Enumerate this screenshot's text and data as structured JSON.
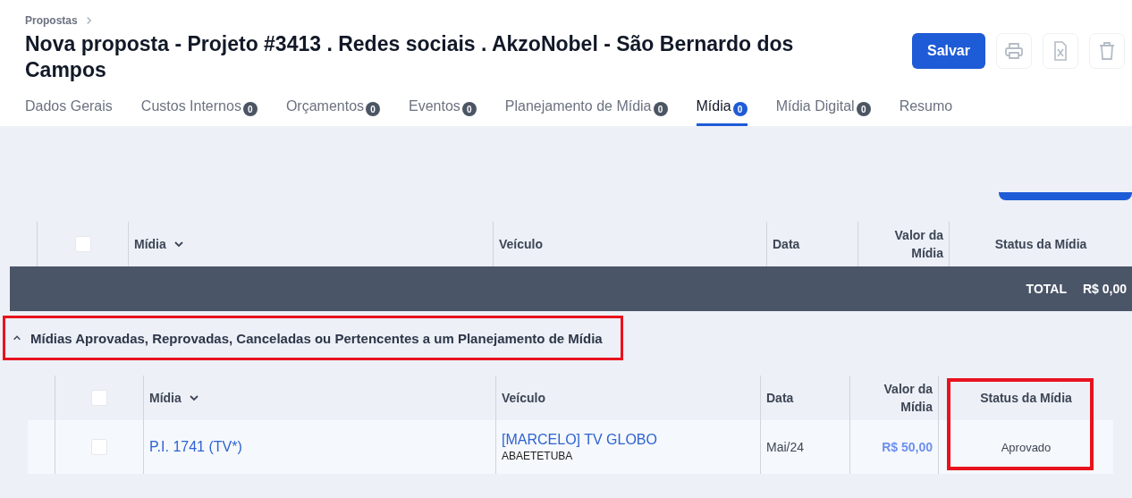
{
  "breadcrumb": "Propostas",
  "title": "Nova proposta - Projeto #3413 . Redes sociais . AkzoNobel - São Bernardo dos Campos",
  "save_button": "Salvar",
  "tabs": [
    {
      "label": "Dados Gerais",
      "selected": false
    },
    {
      "label": "Custos Internos",
      "count": "0",
      "selected": false
    },
    {
      "label": "Orçamentos",
      "count": "0",
      "selected": false
    },
    {
      "label": "Eventos",
      "count": "0",
      "selected": false
    },
    {
      "label": "Planejamento de Mídia",
      "count": "0",
      "selected": false
    },
    {
      "label": "Mídia",
      "count": "0",
      "selected": true
    },
    {
      "label": "Mídia Digital",
      "count": "0",
      "selected": false
    },
    {
      "label": "Resumo",
      "selected": false
    }
  ],
  "table": {
    "columns": [
      {
        "label": "Mídia",
        "sortable": true
      },
      {
        "label": "Veículo"
      },
      {
        "label": "Data"
      },
      {
        "label": "Valor da Mídia"
      },
      {
        "label": "Status da Mídia"
      }
    ],
    "checked": false,
    "total_label": "TOTAL",
    "total_value": "R$ 0,00"
  },
  "section": {
    "title": "Mídias Aprovadas, Reprovadas, Canceladas ou Pertencentes a um Planejamento de Mídia",
    "expanded": true,
    "highlighted": true
  },
  "table2": {
    "columns": [
      {
        "label": "Mídia",
        "sortable": true
      },
      {
        "label": "Veículo"
      },
      {
        "label": "Data"
      },
      {
        "label": "Valor da Mídia"
      },
      {
        "label": "Status da Mídia",
        "highlighted": true
      }
    ],
    "checked": false,
    "rows": [
      {
        "checked": false,
        "media": "P.I. 1741 (TV*)",
        "vehicle": "[MARCELO] TV GLOBO",
        "vehicle_sub": "ABAETETUBA",
        "date": "Mai/24",
        "value": "R$ 50,00",
        "status": "Aprovado"
      }
    ]
  }
}
